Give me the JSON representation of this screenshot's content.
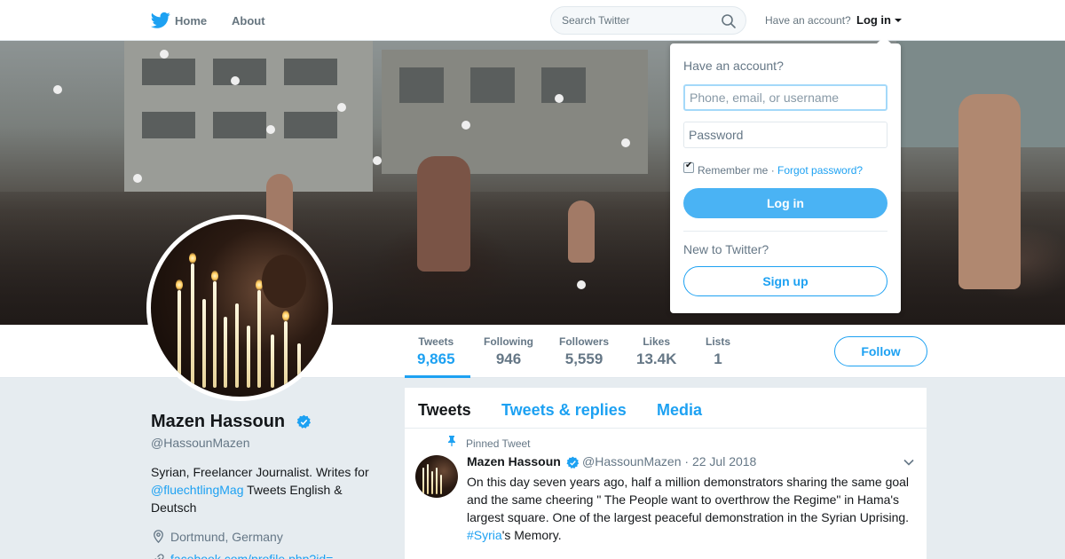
{
  "nav": {
    "home_label": "Home",
    "about_label": "About",
    "search_placeholder": "Search Twitter",
    "have_account": "Have an account?",
    "login_label": "Log in"
  },
  "login_dropdown": {
    "title": "Have an account?",
    "username_placeholder": "Phone, email, or username",
    "password_placeholder": "Password",
    "remember_label": "Remember me",
    "separator": "·",
    "forgot_label": "Forgot password?",
    "login_button": "Log in",
    "new_label": "New to Twitter?",
    "signup_button": "Sign up"
  },
  "stats": [
    {
      "label": "Tweets",
      "value": "9,865"
    },
    {
      "label": "Following",
      "value": "946"
    },
    {
      "label": "Followers",
      "value": "5,559"
    },
    {
      "label": "Likes",
      "value": "13.4K"
    },
    {
      "label": "Lists",
      "value": "1"
    }
  ],
  "follow_button": "Follow",
  "profile": {
    "name": "Mazen Hassoun",
    "handle": "@HassounMazen",
    "bio_prefix": "Syrian, Freelancer Journalist. Writes for",
    "bio_link": "@fluechtlingMag",
    "bio_suffix": "Tweets English & Deutsch",
    "location": "Dortmund, Germany",
    "website": "facebook.com/profile.php?id=..."
  },
  "timeline": {
    "tabs": [
      "Tweets",
      "Tweets & replies",
      "Media"
    ],
    "pinned_label": "Pinned Tweet",
    "tweet": {
      "name": "Mazen Hassoun",
      "handle": "@HassounMazen",
      "separator": "·",
      "date": "22 Jul 2018",
      "text": "On this day seven years ago, half a million demonstrators sharing the same goal and the same cheering \" The People want to overthrow the Regime\" in Hama's largest square. One of the largest peaceful demonstration in the Syrian Uprising.",
      "hashtag": "#Syria",
      "text_end": "'s Memory."
    }
  },
  "colors": {
    "accent": "#1da1f2",
    "background": "#e6ecf0",
    "text": "#14171a",
    "muted": "#657786"
  }
}
